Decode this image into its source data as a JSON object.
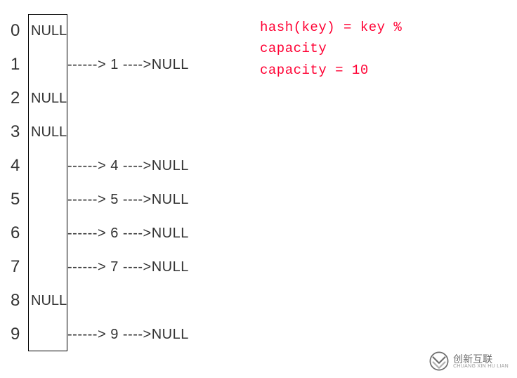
{
  "table": {
    "rows": [
      {
        "index": "0",
        "bucket": "NULL",
        "chain": ""
      },
      {
        "index": "1",
        "bucket": "",
        "chain": "------> 1 ---->NULL"
      },
      {
        "index": "2",
        "bucket": "NULL",
        "chain": ""
      },
      {
        "index": "3",
        "bucket": "NULL",
        "chain": ""
      },
      {
        "index": "4",
        "bucket": "",
        "chain": "------> 4 ---->NULL"
      },
      {
        "index": "5",
        "bucket": "",
        "chain": "------> 5 ---->NULL"
      },
      {
        "index": "6",
        "bucket": "",
        "chain": "------> 6 ---->NULL"
      },
      {
        "index": "7",
        "bucket": "",
        "chain": "------> 7 ---->NULL"
      },
      {
        "index": "8",
        "bucket": "NULL",
        "chain": ""
      },
      {
        "index": "9",
        "bucket": "",
        "chain": "------> 9 ---->NULL"
      }
    ]
  },
  "formula": {
    "line1": "hash(key) = key %",
    "line2": "capacity",
    "line3": "capacity = 10"
  },
  "watermark": {
    "cn": "创新互联",
    "en": "CHUANG XIN HU LIAN"
  },
  "chart_data": {
    "type": "table",
    "title": "Hash table with chaining",
    "hash_function": "hash(key) = key % capacity",
    "capacity": 10,
    "buckets": [
      {
        "index": 0,
        "chain": null
      },
      {
        "index": 1,
        "chain": [
          1
        ]
      },
      {
        "index": 2,
        "chain": null
      },
      {
        "index": 3,
        "chain": null
      },
      {
        "index": 4,
        "chain": [
          4
        ]
      },
      {
        "index": 5,
        "chain": [
          5
        ]
      },
      {
        "index": 6,
        "chain": [
          6
        ]
      },
      {
        "index": 7,
        "chain": [
          7
        ]
      },
      {
        "index": 8,
        "chain": null
      },
      {
        "index": 9,
        "chain": [
          9
        ]
      }
    ]
  }
}
